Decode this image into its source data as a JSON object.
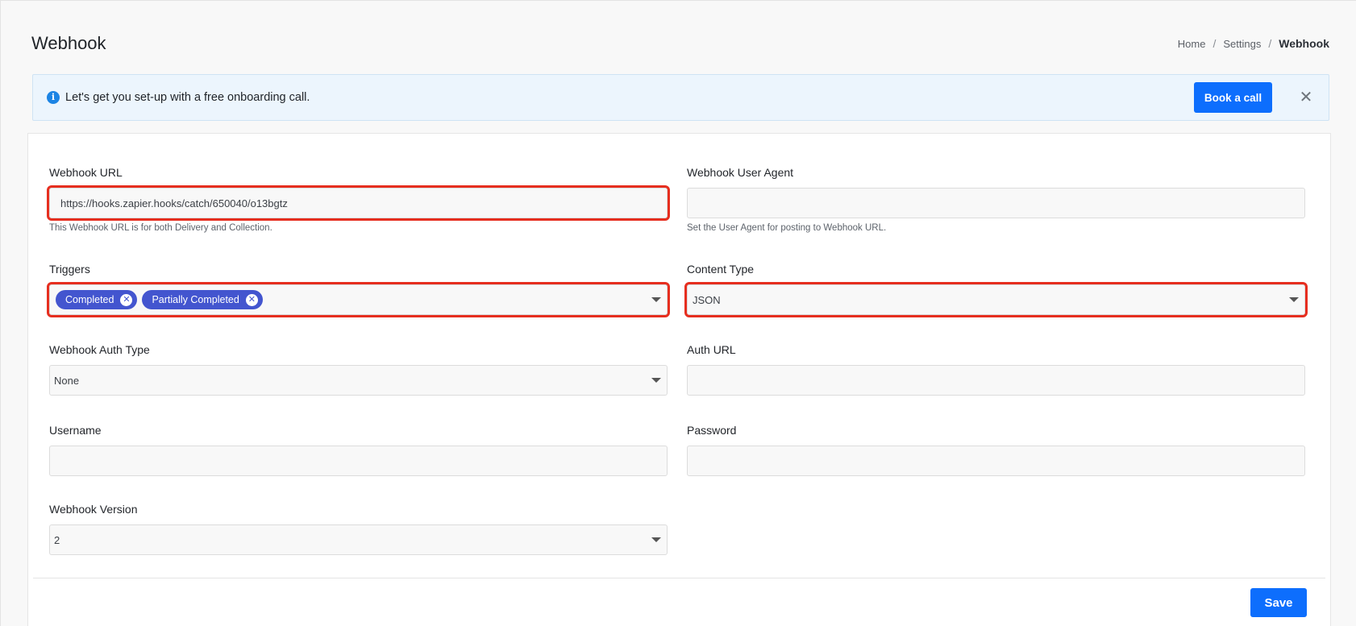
{
  "header": {
    "title": "Webhook",
    "breadcrumb": [
      "Home",
      "Settings",
      "Webhook"
    ],
    "separator": "/"
  },
  "alert": {
    "icon": "info-icon",
    "text": "Let's get you set-up with a free onboarding call.",
    "button_label": "Book a call",
    "close_icon": "close-icon",
    "close_glyph": "✕"
  },
  "form": {
    "webhook_url": {
      "label": "Webhook URL",
      "value": "https://hooks.zapier.hooks/catch/650040/o13bgtz",
      "help": "This Webhook URL is for both Delivery and Collection."
    },
    "user_agent": {
      "label": "Webhook User Agent",
      "value": "",
      "help": "Set the User Agent for posting to Webhook URL."
    },
    "triggers": {
      "label": "Triggers",
      "tags": [
        "Completed",
        "Partially Completed"
      ]
    },
    "content_type": {
      "label": "Content Type",
      "value": "JSON"
    },
    "auth_type": {
      "label": "Webhook Auth Type",
      "value": "None"
    },
    "auth_url": {
      "label": "Auth URL",
      "value": ""
    },
    "username": {
      "label": "Username",
      "value": ""
    },
    "password": {
      "label": "Password",
      "value": ""
    },
    "version": {
      "label": "Webhook Version",
      "value": "2"
    }
  },
  "footer": {
    "save_label": "Save"
  },
  "colors": {
    "primary": "#0d6efd",
    "tag": "#4355cf",
    "highlight": "#e62e1f",
    "alert_bg": "#ecf5fd"
  }
}
